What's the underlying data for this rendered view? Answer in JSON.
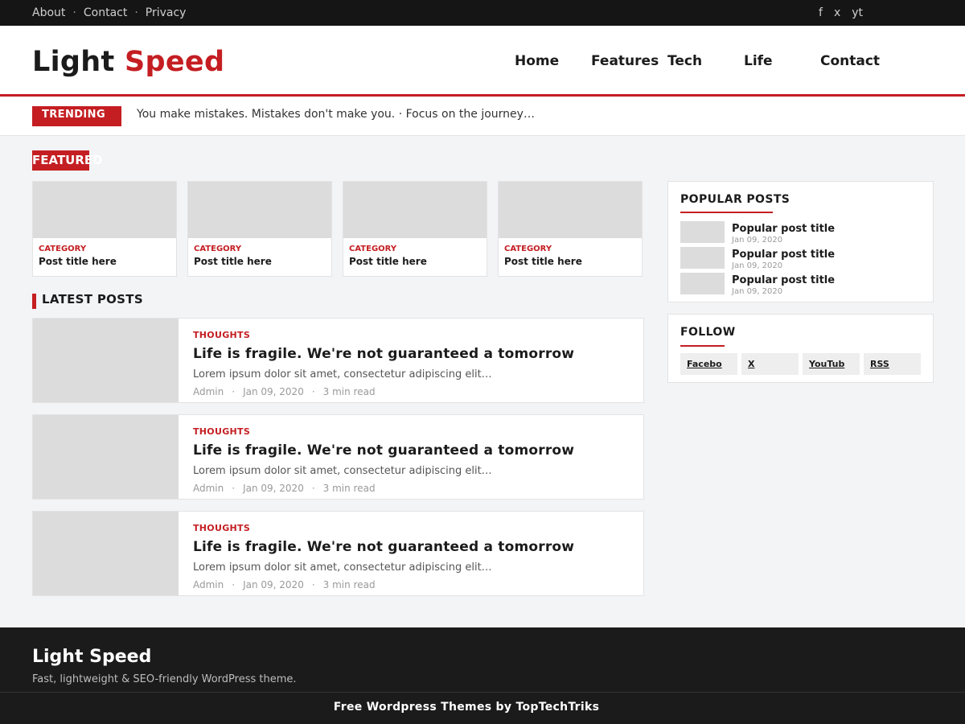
{
  "topbar": {
    "links": [
      "About",
      "Contact",
      "Privacy"
    ],
    "separator": "·",
    "social": [
      "f",
      "x",
      "yt"
    ]
  },
  "header": {
    "logo_part1": "Light",
    "logo_part2": "Speed",
    "nav": [
      "Home",
      "Features",
      "Tech",
      "Life",
      "Contact"
    ]
  },
  "trending": {
    "badge": "TRENDING",
    "text": "You make mistakes. Mistakes don't make you.  ·  Focus on the journey…"
  },
  "featured": {
    "label": "FEATURED",
    "cards": [
      {
        "category": "CATEGORY",
        "title": "Post title here"
      },
      {
        "category": "CATEGORY",
        "title": "Post title here"
      },
      {
        "category": "CATEGORY",
        "title": "Post title here"
      },
      {
        "category": "CATEGORY",
        "title": "Post title here"
      }
    ]
  },
  "latest": {
    "heading": "LATEST POSTS",
    "posts": [
      {
        "category": "THOUGHTS",
        "title": "Life is fragile. We're not guaranteed a tomorrow",
        "excerpt": "Lorem ipsum dolor sit amet, consectetur adipiscing elit…",
        "author": "Admin",
        "date": "Jan 09, 2020",
        "read": "3 min read"
      },
      {
        "category": "THOUGHTS",
        "title": "Life is fragile. We're not guaranteed a tomorrow",
        "excerpt": "Lorem ipsum dolor sit amet, consectetur adipiscing elit…",
        "author": "Admin",
        "date": "Jan 09, 2020",
        "read": "3 min read"
      },
      {
        "category": "THOUGHTS",
        "title": "Life is fragile. We're not guaranteed a tomorrow",
        "excerpt": "Lorem ipsum dolor sit amet, consectetur adipiscing elit…",
        "author": "Admin",
        "date": "Jan 09, 2020",
        "read": "3 min read"
      }
    ]
  },
  "sidebar": {
    "popular": {
      "title": "POPULAR POSTS",
      "items": [
        {
          "title": "Popular post title",
          "date": "Jan 09, 2020"
        },
        {
          "title": "Popular post title",
          "date": "Jan 09, 2020"
        },
        {
          "title": "Popular post title",
          "date": "Jan 09, 2020"
        }
      ]
    },
    "follow": {
      "title": "FOLLOW",
      "buttons": [
        "Facebo",
        "X",
        "YouTub",
        "RSS"
      ]
    }
  },
  "footer": {
    "title": "Light Speed",
    "tagline": "Fast, lightweight & SEO-friendly WordPress theme.",
    "credit": "Free Wordpress Themes by TopTechTriks"
  },
  "colors": {
    "accent": "#c41e22",
    "topbar_bg": "#151515",
    "footer_bg": "#1b1b1b",
    "page_bg": "#f3f4f6"
  }
}
